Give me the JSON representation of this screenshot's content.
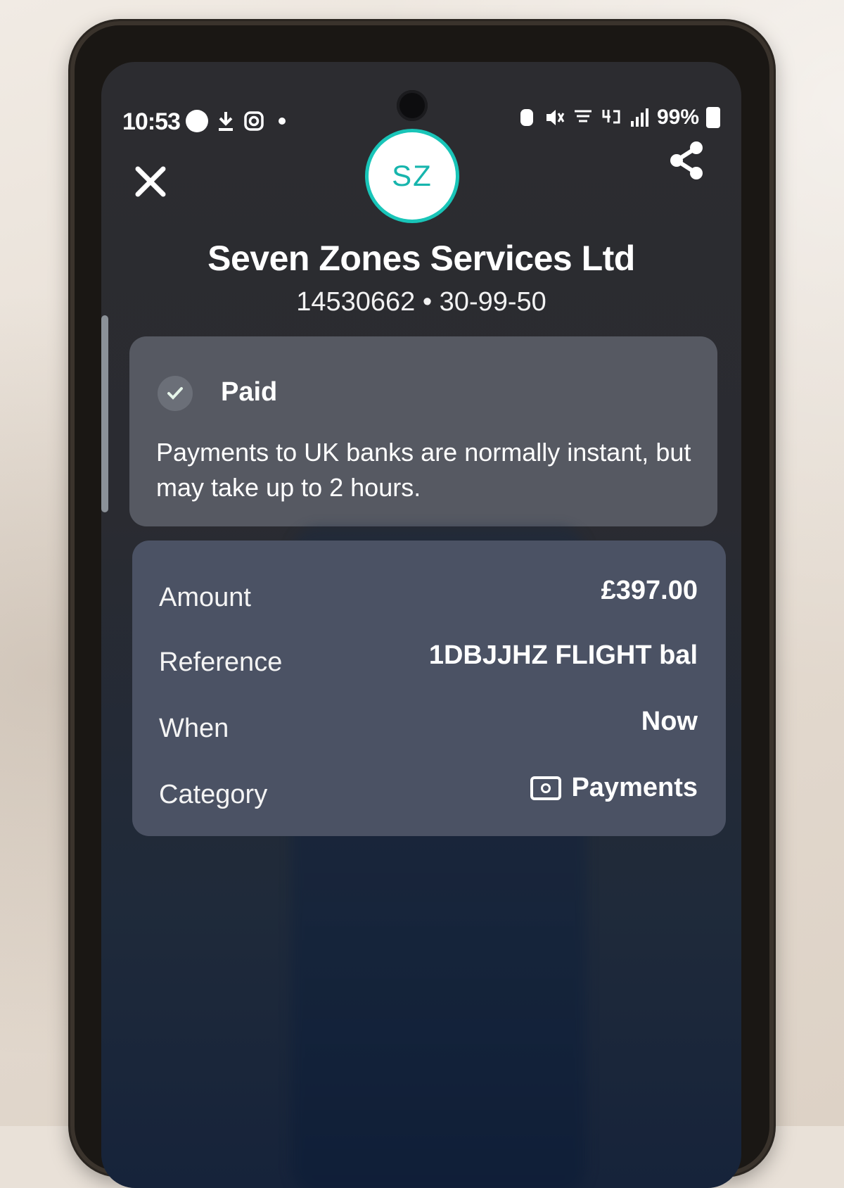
{
  "status_bar": {
    "time": "10:53",
    "battery": "99%"
  },
  "avatar": {
    "initials": "SZ"
  },
  "payee": {
    "name": "Seven Zones Services Ltd",
    "account": "14530662 • 30-99-50"
  },
  "payment_status": {
    "title": "Paid",
    "description": "Payments to UK banks are normally instant, but may take up to 2 hours."
  },
  "details": {
    "amount_label": "Amount",
    "amount_value": "£397.00",
    "reference_label": "Reference",
    "reference_value": "1DBJJHZ FLIGHT bal",
    "when_label": "When",
    "when_value": "Now",
    "category_label": "Category",
    "category_value": "Payments"
  },
  "icons": {
    "close": "close-icon",
    "share": "share-icon",
    "check": "check-icon",
    "category": "payments-icon"
  },
  "colors": {
    "accent": "#19c5b8",
    "screen_bg": "#2c2c30",
    "card_bg": "#4a4d57"
  }
}
